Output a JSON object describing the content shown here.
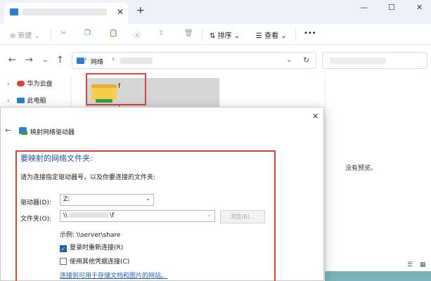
{
  "tabs": {
    "close_glyph": "✕",
    "new_tab_glyph": "+"
  },
  "window": {
    "minimize": "—",
    "maximize": "☐",
    "close": "✕"
  },
  "toolbar": {
    "new_label": "新建",
    "sort_label": "排序",
    "view_label": "查看",
    "more_label": "•••"
  },
  "address": {
    "segment1": "网络",
    "chevron": "›"
  },
  "sidebar": {
    "items": [
      {
        "label": "华为云盘"
      },
      {
        "label": "此电脑"
      }
    ]
  },
  "content": {
    "folder_name": "f"
  },
  "preview": {
    "text": "没有预览。"
  },
  "dialog": {
    "title": "映射网络驱动器",
    "heading": "要映射的网络文件夹:",
    "instruction": "请为连接指定驱动器号，以及你要连接的文件夹:",
    "drive_label": "驱动器(D):",
    "drive_value": "Z:",
    "folder_label": "文件夹(O):",
    "folder_prefix": "\\\\",
    "folder_suffix": "\\f",
    "browse_label": "浏览(B)...",
    "example": "示例: \\\\server\\share",
    "reconnect_label": "登录时重新连接(R)",
    "reconnect_checked": true,
    "other_creds_label": "使用其他凭据连接(C)",
    "other_creds_checked": false,
    "link_text": "连接到可用于存储文档和图片的网站。"
  },
  "colors": {
    "accent": "#1f5fb5",
    "highlight_red": "#d9453f",
    "heading_blue": "#1f4e9e"
  }
}
